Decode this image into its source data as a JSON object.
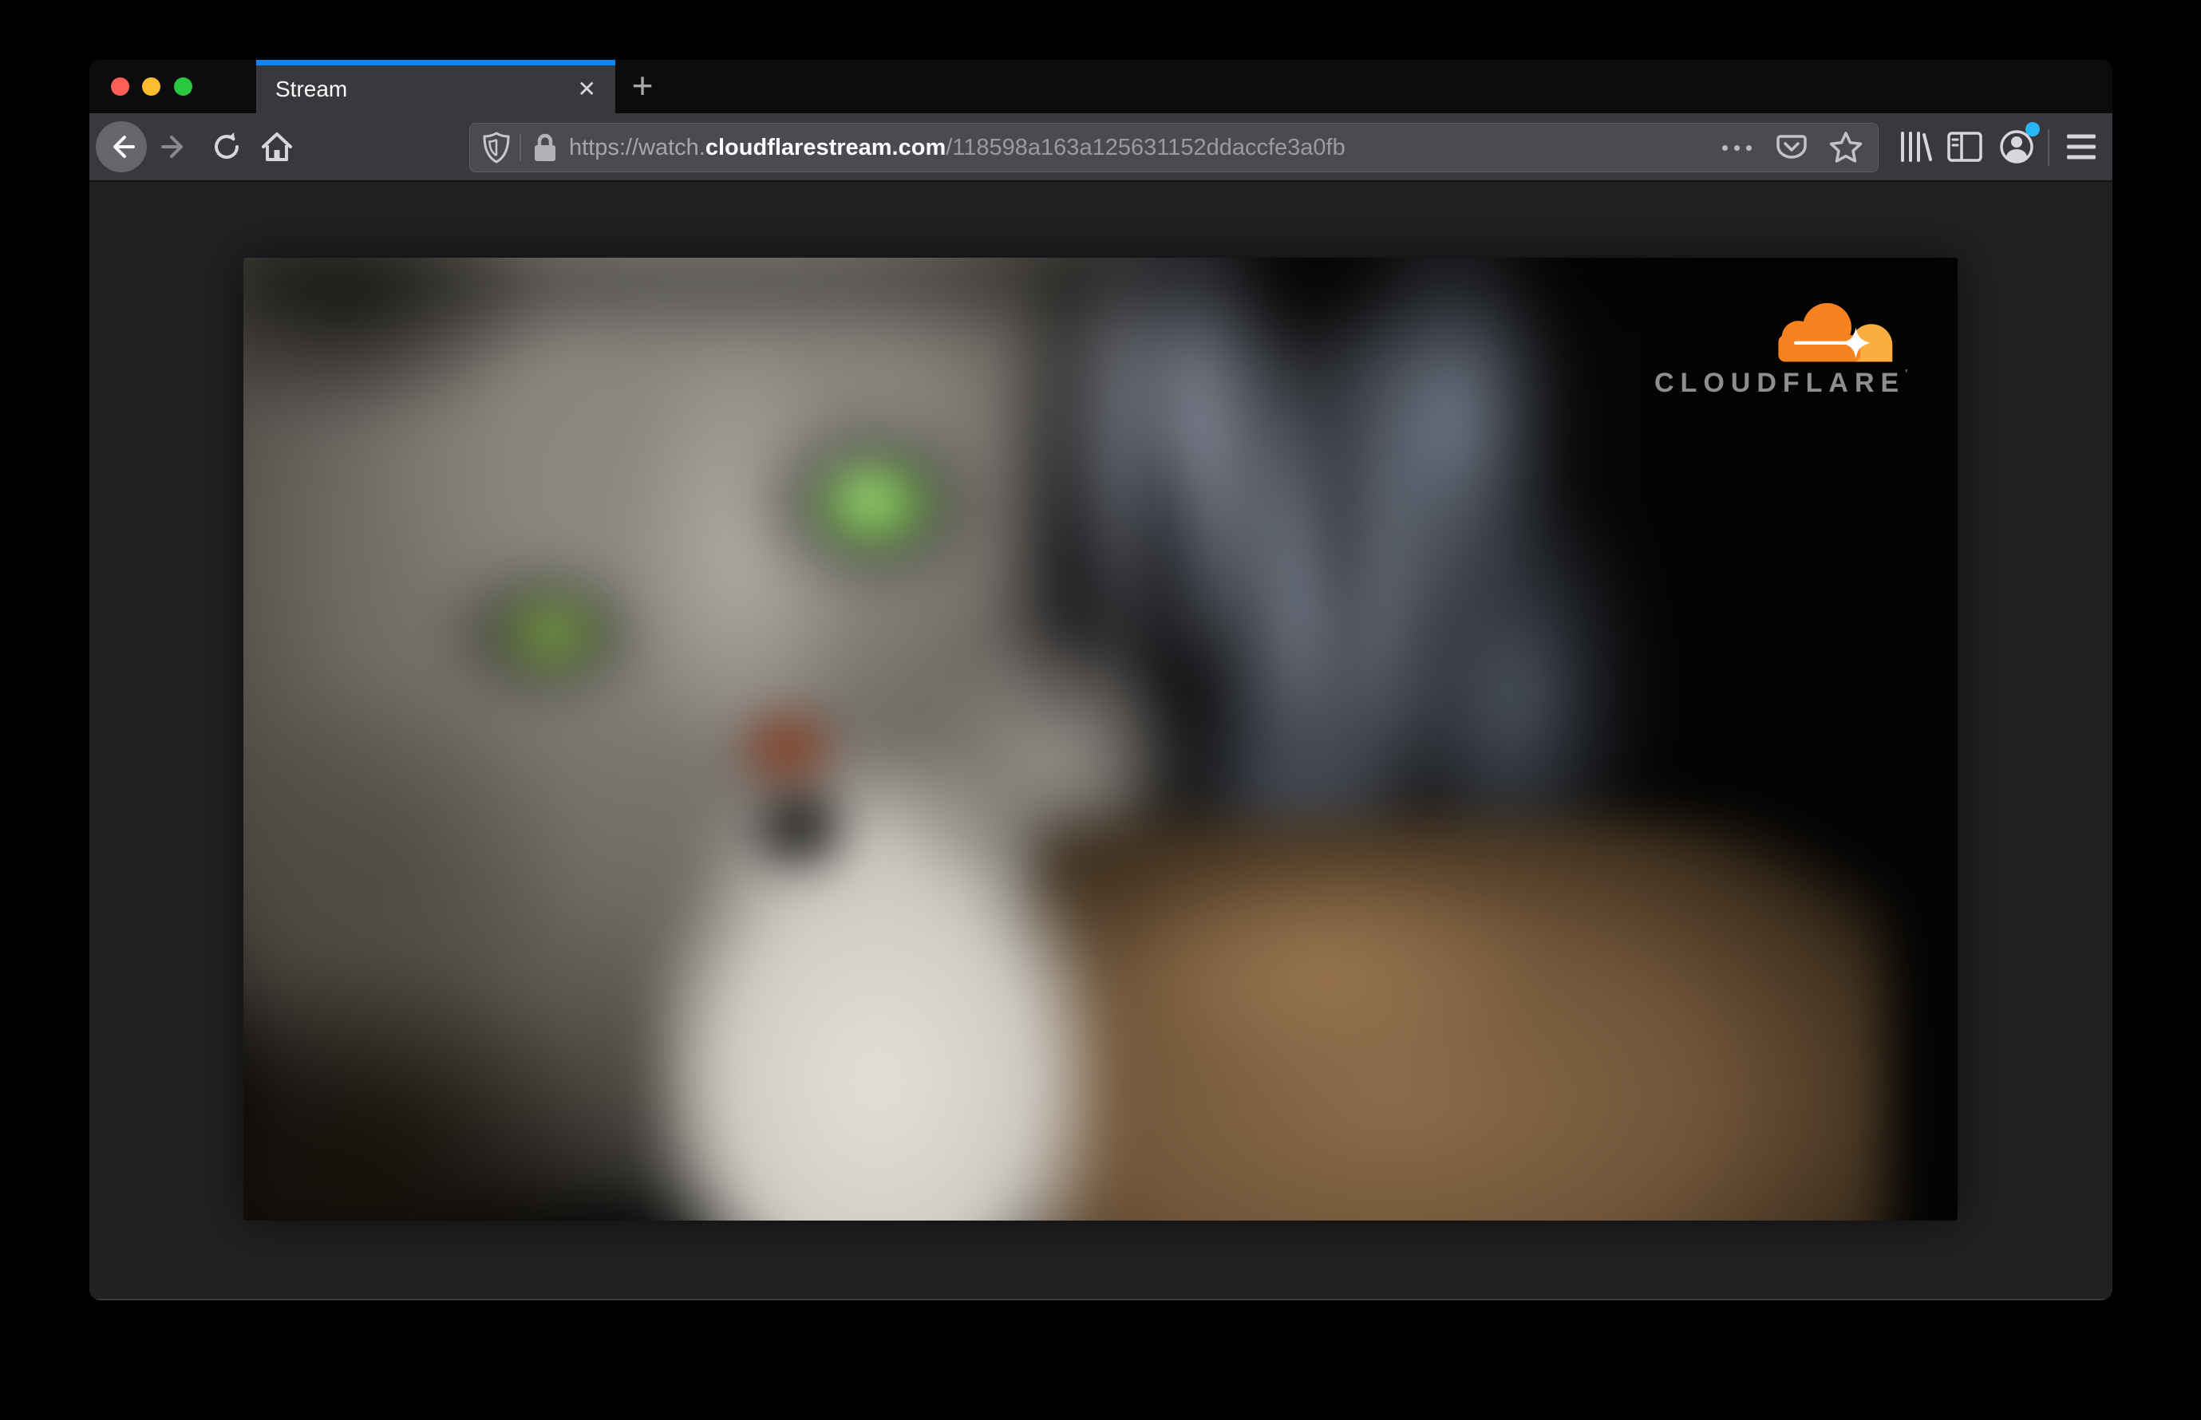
{
  "window": {
    "traffic_lights": {
      "close_color": "#ff5f57",
      "minimize_color": "#febc2e",
      "zoom_color": "#28c840"
    },
    "tab": {
      "title": "Stream",
      "close_glyph": "✕",
      "active_line_color": "#0a84ff"
    },
    "new_tab_glyph": "+",
    "toolbar": {
      "url": {
        "scheme_host_prefix": "https://watch.",
        "domain": "cloudflarestream.com",
        "path": "/118598a163a125631152ddaccfe3a0fb"
      },
      "notification_dot_color": "#29b6f6",
      "icons": [
        "back-icon",
        "forward-icon",
        "reload-icon",
        "home-icon",
        "tracking-protection-shield-icon",
        "lock-icon",
        "page-actions-dots-icon",
        "pocket-icon",
        "bookmark-star-icon",
        "library-icon",
        "sidebar-icon",
        "account-icon",
        "menu-hamburger-icon"
      ]
    }
  },
  "content": {
    "video": {
      "description": "Blurred close-up of a grey tabby cat with green eyes",
      "brand": {
        "wordmark": "CLOUDFLARE",
        "trademark_tick": "'",
        "cloud_main_color": "#f6821f",
        "cloud_light_color": "#fbad41"
      }
    }
  }
}
